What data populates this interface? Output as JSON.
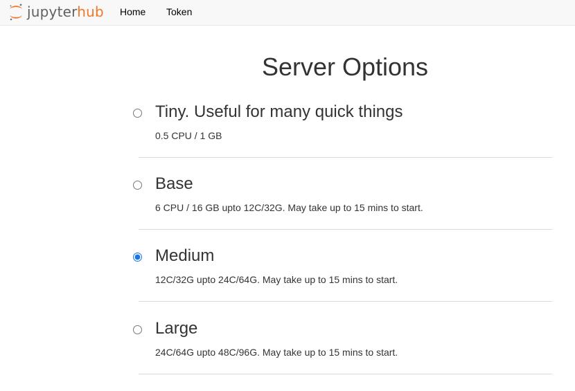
{
  "nav": {
    "logo_prefix": "jupyter",
    "logo_suffix": "hub",
    "items": [
      {
        "label": "Home"
      },
      {
        "label": "Token"
      }
    ]
  },
  "page": {
    "title": "Server Options"
  },
  "options": [
    {
      "title": "Tiny. Useful for many quick things",
      "description": "0.5 CPU / 1 GB",
      "selected": false
    },
    {
      "title": "Base",
      "description": "6 CPU / 16 GB upto 12C/32G. May take up to 15 mins to start.",
      "selected": false
    },
    {
      "title": "Medium",
      "description": "12C/32G upto 24C/64G. May take up to 15 mins to start.",
      "selected": true
    },
    {
      "title": "Large",
      "description": "24C/64G upto 48C/96G. May take up to 15 mins to start.",
      "selected": false
    }
  ],
  "colors": {
    "logo_orange": "#f37726",
    "logo_gray": "#616161",
    "radio_accent": "#1a73e8"
  },
  "icons": {
    "logo": "jupyter-logo-icon"
  }
}
